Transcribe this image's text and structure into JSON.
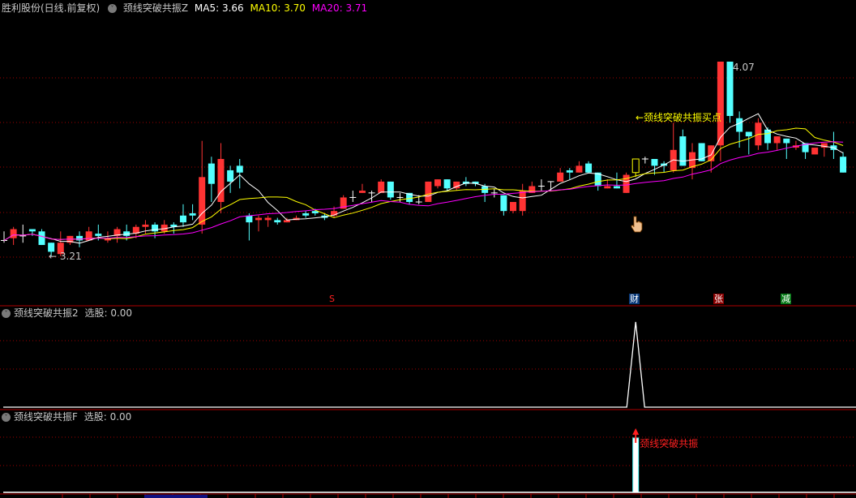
{
  "header": {
    "stock": "胜利股份(日线.前复权)",
    "indicator": "颈线突破共振Z",
    "ma5": "MA5: 3.66",
    "ma10": "MA10: 3.70",
    "ma20": "MA20: 3.71"
  },
  "panel2": {
    "title": "颈线突破共振2",
    "value": "选股: 0.00"
  },
  "panel3": {
    "title": "颈线突破共振F",
    "value": "选股: 0.00",
    "signal_label": "颈线突破共振"
  },
  "colors": {
    "up": "#ff3333",
    "down": "#54ffff",
    "ma5": "#ffffff",
    "ma10": "#ffff00",
    "ma20": "#ff00ff",
    "grid": "#a00000"
  },
  "markers": {
    "s": "S",
    "cai": "财",
    "zhang": "张",
    "jian": "减"
  },
  "chart_data": {
    "type": "candlestick",
    "title": "胜利股份(日线.前复权)",
    "ylim": [
      3.21,
      4.07
    ],
    "annotations": {
      "high_label": "4.07",
      "low_label": "← 3.21",
      "buy_point": "←颈线突破共振买点"
    },
    "ma_periods": [
      5,
      10,
      20
    ],
    "signal_index": 67,
    "candles": [
      [
        3.28,
        3.32,
        3.27,
        3.28
      ],
      [
        3.29,
        3.34,
        3.26,
        3.33
      ],
      [
        3.3,
        3.35,
        3.27,
        3.3
      ],
      [
        3.33,
        3.33,
        3.3,
        3.32
      ],
      [
        3.32,
        3.33,
        3.26,
        3.26
      ],
      [
        3.27,
        3.27,
        3.21,
        3.23
      ],
      [
        3.22,
        3.32,
        3.21,
        3.27
      ],
      [
        3.27,
        3.3,
        3.26,
        3.3
      ],
      [
        3.3,
        3.32,
        3.25,
        3.28
      ],
      [
        3.28,
        3.34,
        3.28,
        3.32
      ],
      [
        3.31,
        3.35,
        3.28,
        3.3
      ],
      [
        3.28,
        3.32,
        3.27,
        3.29
      ],
      [
        3.3,
        3.34,
        3.27,
        3.33
      ],
      [
        3.32,
        3.35,
        3.28,
        3.3
      ],
      [
        3.31,
        3.35,
        3.29,
        3.34
      ],
      [
        3.34,
        3.37,
        3.31,
        3.35
      ],
      [
        3.35,
        3.36,
        3.29,
        3.32
      ],
      [
        3.32,
        3.37,
        3.31,
        3.35
      ],
      [
        3.35,
        3.36,
        3.31,
        3.34
      ],
      [
        3.39,
        3.44,
        3.34,
        3.36
      ],
      [
        3.4,
        3.44,
        3.37,
        3.39
      ],
      [
        3.35,
        3.72,
        3.31,
        3.56
      ],
      [
        3.62,
        3.65,
        3.45,
        3.53
      ],
      [
        3.45,
        3.71,
        3.4,
        3.64
      ],
      [
        3.59,
        3.61,
        3.49,
        3.54
      ],
      [
        3.61,
        3.64,
        3.51,
        3.58
      ],
      [
        3.39,
        3.4,
        3.28,
        3.36
      ],
      [
        3.37,
        3.39,
        3.32,
        3.38
      ],
      [
        3.37,
        3.39,
        3.34,
        3.38
      ],
      [
        3.37,
        3.38,
        3.35,
        3.36
      ],
      [
        3.36,
        3.38,
        3.36,
        3.37
      ],
      [
        3.37,
        3.39,
        3.37,
        3.38
      ],
      [
        3.4,
        3.41,
        3.38,
        3.39
      ],
      [
        3.41,
        3.42,
        3.39,
        3.4
      ],
      [
        3.39,
        3.4,
        3.37,
        3.38
      ],
      [
        3.39,
        3.43,
        3.38,
        3.41
      ],
      [
        3.42,
        3.48,
        3.42,
        3.47
      ],
      [
        3.47,
        3.5,
        3.45,
        3.47
      ],
      [
        3.49,
        3.53,
        3.49,
        3.5
      ],
      [
        3.49,
        3.5,
        3.45,
        3.49
      ],
      [
        3.49,
        3.55,
        3.49,
        3.54
      ],
      [
        3.54,
        3.54,
        3.46,
        3.47
      ],
      [
        3.47,
        3.49,
        3.45,
        3.47
      ],
      [
        3.49,
        3.49,
        3.44,
        3.45
      ],
      [
        3.45,
        3.48,
        3.44,
        3.45
      ],
      [
        3.45,
        3.54,
        3.45,
        3.54
      ],
      [
        3.52,
        3.55,
        3.51,
        3.55
      ],
      [
        3.55,
        3.55,
        3.5,
        3.51
      ],
      [
        3.51,
        3.54,
        3.5,
        3.54
      ],
      [
        3.54,
        3.56,
        3.52,
        3.53
      ],
      [
        3.54,
        3.54,
        3.52,
        3.53
      ],
      [
        3.52,
        3.53,
        3.45,
        3.49
      ],
      [
        3.49,
        3.51,
        3.47,
        3.49
      ],
      [
        3.48,
        3.48,
        3.39,
        3.41
      ],
      [
        3.41,
        3.45,
        3.4,
        3.45
      ],
      [
        3.41,
        3.53,
        3.39,
        3.5
      ],
      [
        3.49,
        3.54,
        3.49,
        3.52
      ],
      [
        3.52,
        3.55,
        3.5,
        3.52
      ],
      [
        3.54,
        3.54,
        3.5,
        3.54
      ],
      [
        3.54,
        3.6,
        3.54,
        3.58
      ],
      [
        3.59,
        3.6,
        3.55,
        3.58
      ],
      [
        3.58,
        3.63,
        3.58,
        3.61
      ],
      [
        3.62,
        3.63,
        3.58,
        3.58
      ],
      [
        3.58,
        3.58,
        3.5,
        3.52
      ],
      [
        3.51,
        3.55,
        3.51,
        3.52
      ],
      [
        3.52,
        3.58,
        3.51,
        3.51
      ],
      [
        3.49,
        3.58,
        3.49,
        3.57
      ],
      [
        3.58,
        3.64,
        3.56,
        3.64
      ],
      [
        3.64,
        3.65,
        3.62,
        3.64
      ],
      [
        3.64,
        3.64,
        3.57,
        3.61
      ],
      [
        3.62,
        3.63,
        3.58,
        3.61
      ],
      [
        3.59,
        3.8,
        3.58,
        3.68
      ],
      [
        3.74,
        3.77,
        3.61,
        3.61
      ],
      [
        3.6,
        3.71,
        3.55,
        3.67
      ],
      [
        3.71,
        3.71,
        3.63,
        3.63
      ],
      [
        3.63,
        3.7,
        3.58,
        3.7
      ],
      [
        3.7,
        4.07,
        3.63,
        4.07
      ],
      [
        4.07,
        4.07,
        3.8,
        3.83
      ],
      [
        3.82,
        3.85,
        3.69,
        3.76
      ],
      [
        3.76,
        3.76,
        3.66,
        3.74
      ],
      [
        3.7,
        3.82,
        3.68,
        3.8
      ],
      [
        3.77,
        3.78,
        3.68,
        3.71
      ],
      [
        3.71,
        3.74,
        3.68,
        3.74
      ],
      [
        3.73,
        3.73,
        3.64,
        3.71
      ],
      [
        3.69,
        3.72,
        3.68,
        3.7
      ],
      [
        3.71,
        3.71,
        3.64,
        3.67
      ],
      [
        3.66,
        3.69,
        3.66,
        3.69
      ],
      [
        3.69,
        3.71,
        3.65,
        3.71
      ],
      [
        3.7,
        3.76,
        3.64,
        3.68
      ],
      [
        3.65,
        3.67,
        3.58,
        3.58
      ]
    ]
  }
}
